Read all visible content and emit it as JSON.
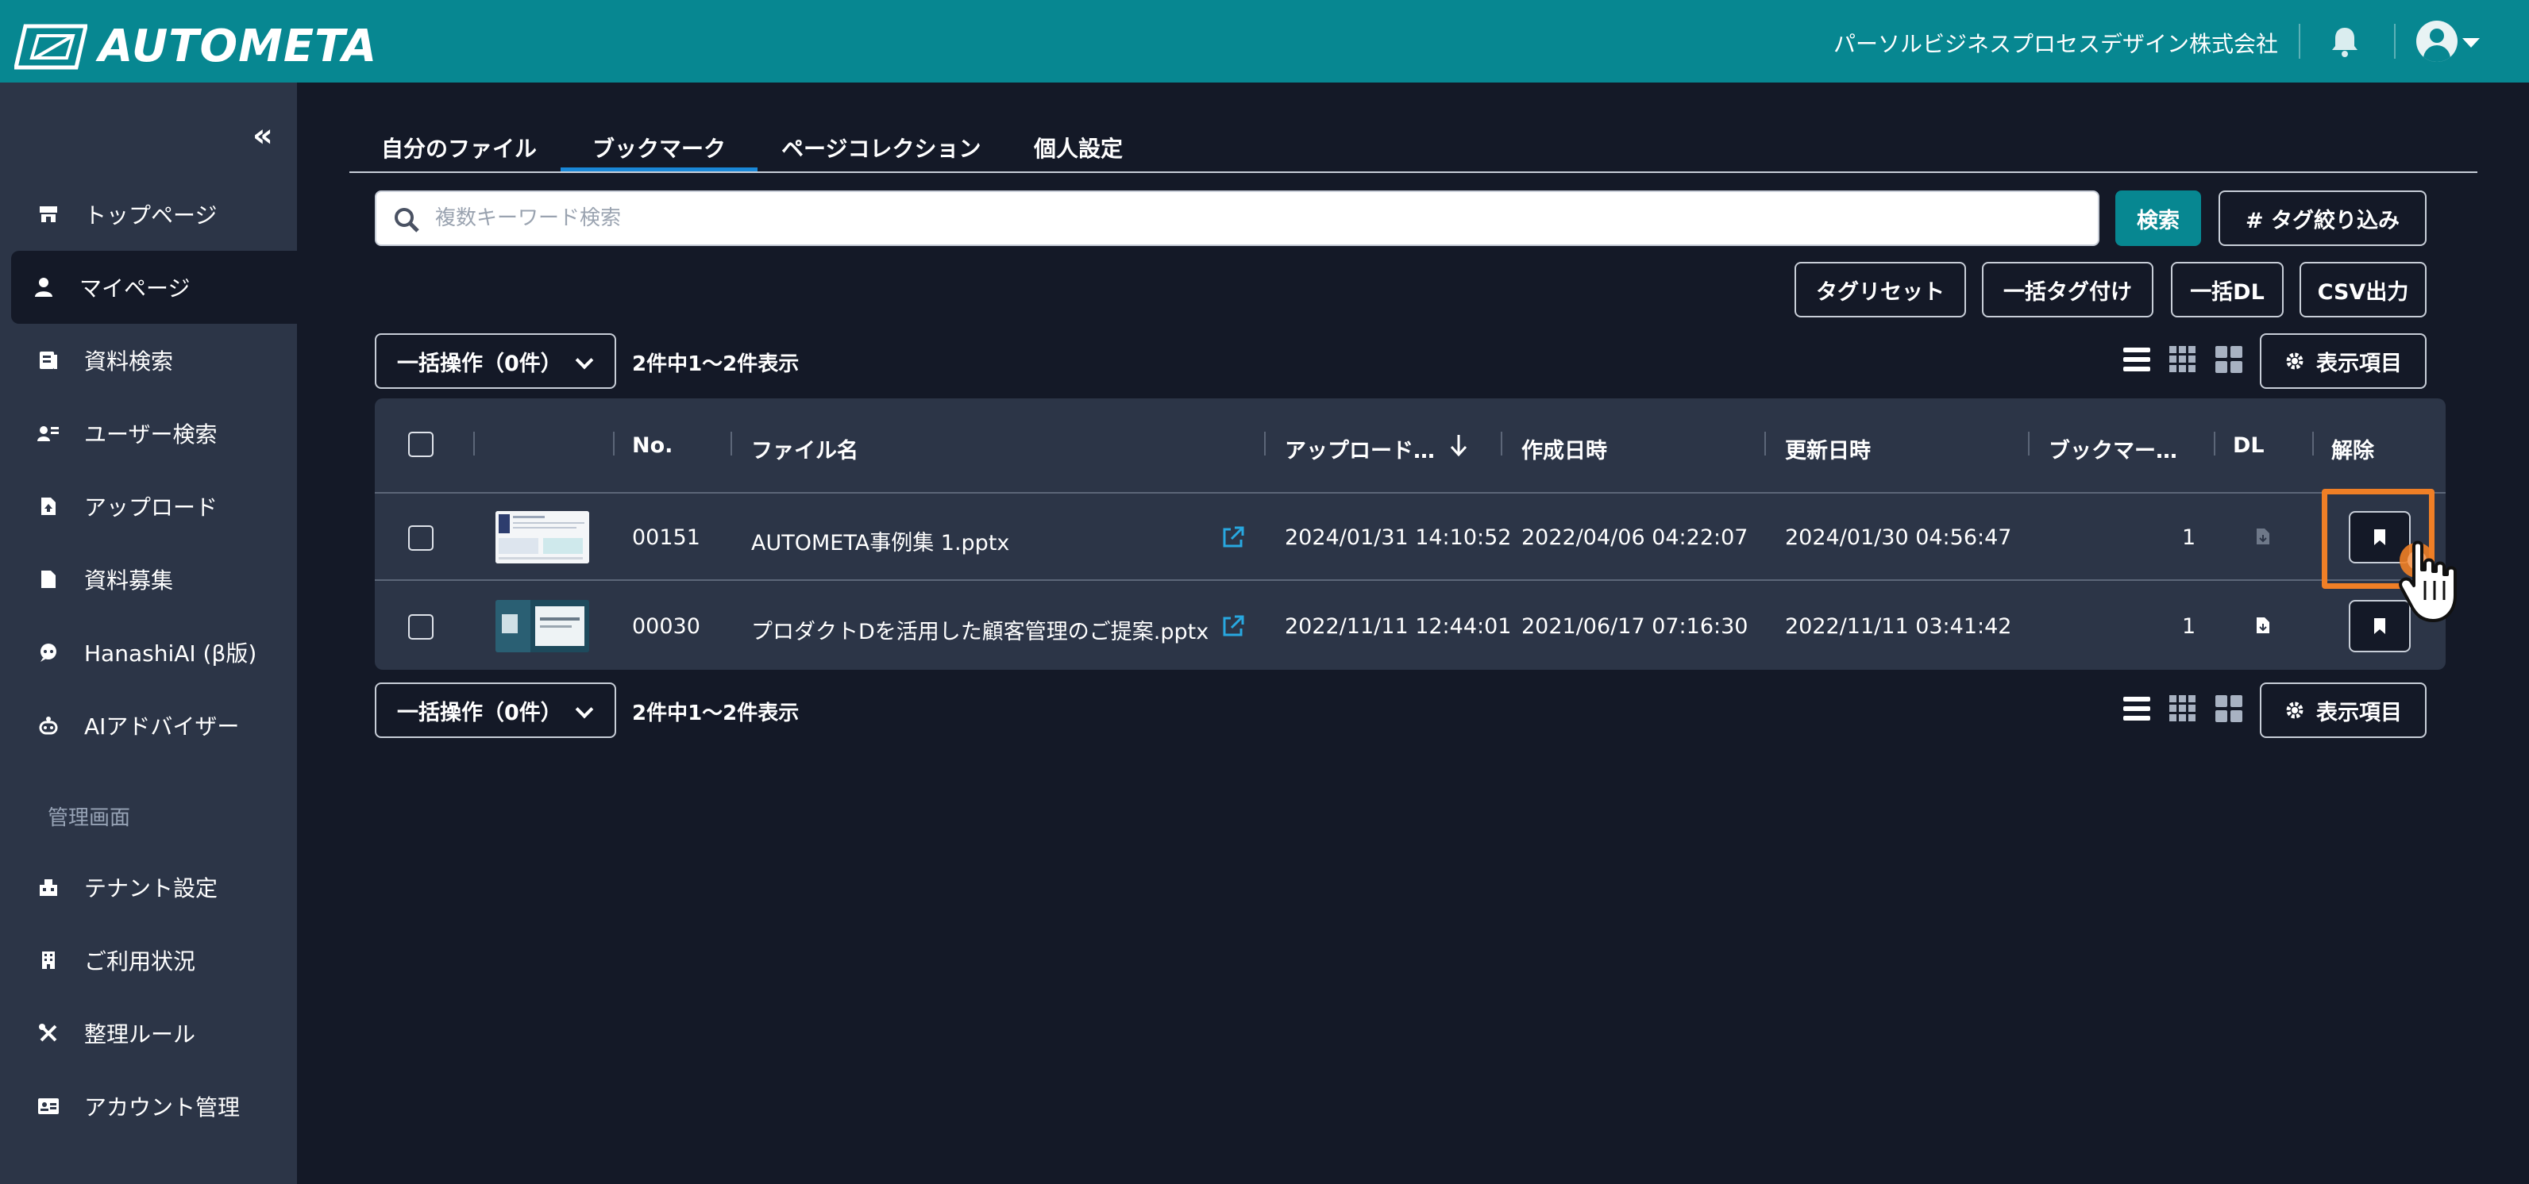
{
  "app": {
    "brand": "AUTOMETA",
    "company": "パーソルビジネスプロセスデザイン株式会社"
  },
  "sidebar": {
    "collapse_glyph": "«",
    "items": [
      {
        "label": "トップページ",
        "icon": "store-icon"
      },
      {
        "label": "マイページ",
        "icon": "user-icon",
        "active": true
      },
      {
        "label": "資料検索",
        "icon": "document-search-icon"
      },
      {
        "label": "ユーザー検索",
        "icon": "user-search-icon"
      },
      {
        "label": "アップロード",
        "icon": "file-upload-icon"
      },
      {
        "label": "資料募集",
        "icon": "file-icon"
      },
      {
        "label": "HanashiAI (β版)",
        "icon": "chat-bot-icon"
      },
      {
        "label": "AIアドバイザー",
        "icon": "robot-icon"
      }
    ],
    "admin_label": "管理画面",
    "admin_items": [
      {
        "label": "テナント設定",
        "icon": "tenant-icon"
      },
      {
        "label": "ご利用状況",
        "icon": "building-icon"
      },
      {
        "label": "整理ルール",
        "icon": "tools-icon"
      },
      {
        "label": "アカウント管理",
        "icon": "id-card-icon"
      }
    ]
  },
  "tabs": [
    {
      "label": "自分のファイル"
    },
    {
      "label": "ブックマーク",
      "active": true
    },
    {
      "label": "ページコレクション"
    },
    {
      "label": "個人設定"
    }
  ],
  "search": {
    "placeholder": "複数キーワード検索",
    "value": "",
    "search_label": "検索",
    "tag_filter_label": "# タグ絞り込み"
  },
  "actions": {
    "tag_reset": "タグリセット",
    "bulk_tag": "一括タグ付け",
    "bulk_dl": "一括DL",
    "csv_export": "CSV出力"
  },
  "toolbar": {
    "bulk_op": "一括操作（0件）",
    "count": "2件中1〜2件表示",
    "display_items": "表示項目"
  },
  "table": {
    "headers": {
      "no": "No.",
      "filename": "ファイル名",
      "uploaded": "アップロード…",
      "created": "作成日時",
      "updated": "更新日時",
      "bookmarks": "ブックマー…",
      "dl": "DL",
      "remove": "解除"
    },
    "rows": [
      {
        "no": "00151",
        "filename": "AUTOMETA事例集 1.pptx",
        "uploaded": "2024/01/31 14:10:52",
        "created": "2022/04/06 04:22:07",
        "updated": "2024/01/30 04:56:47",
        "bookmarks": "1",
        "dl_enabled": false
      },
      {
        "no": "00030",
        "filename": "プロダクトDを活用した顧客管理のご提案.pptx",
        "uploaded": "2022/11/11 12:44:01",
        "created": "2021/06/17 07:16:30",
        "updated": "2022/11/11 03:41:42",
        "bookmarks": "1",
        "dl_enabled": true
      }
    ]
  },
  "colors": {
    "header": "#078791",
    "sidebar": "#2c3547",
    "background": "#141927",
    "accent": "#078791",
    "tab_active": "#1a88d8",
    "highlight": "#f07f26"
  }
}
